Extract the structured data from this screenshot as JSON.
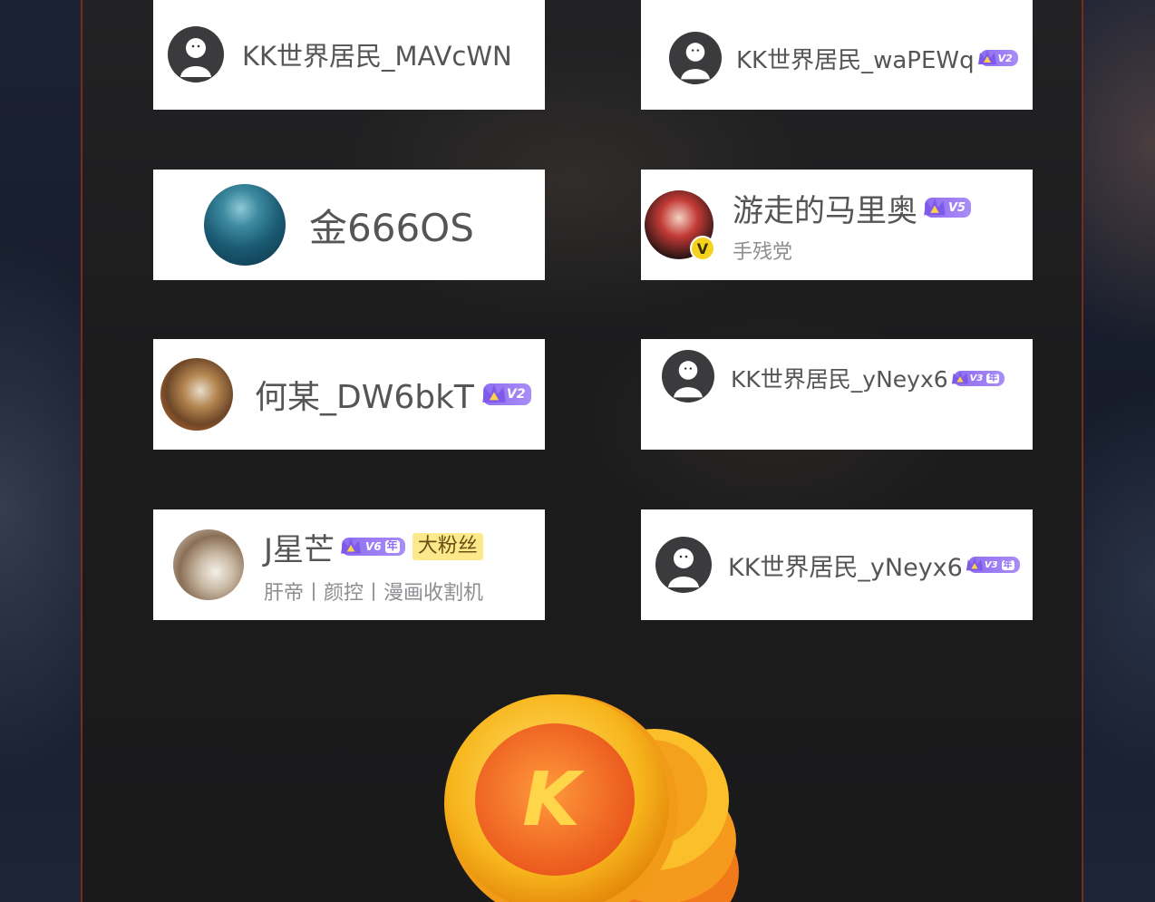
{
  "users": [
    {
      "name": "KK世界居民_MAVcWN",
      "vip": "",
      "avatar": "default-avatar-icon"
    },
    {
      "name": "KK世界居民_waPEWq",
      "vip": "V2",
      "vip_year": "",
      "avatar": "default-avatar-icon"
    },
    {
      "name": "金666OS",
      "vip": "",
      "avatar": "moon-avatar"
    },
    {
      "name": "游走的马里奥",
      "vip": "V5",
      "vip_year": "",
      "subtitle": "手残党",
      "verified_label": "V",
      "avatar": "anime-avatar"
    },
    {
      "name": "何某_DW6bkT",
      "vip": "V2",
      "vip_year": "",
      "avatar": "cartoon-avatar"
    },
    {
      "name": "KK世界居民_yNeyx6",
      "vip": "V3",
      "vip_year": "年",
      "avatar": "default-avatar-icon"
    },
    {
      "name": "J星芒",
      "vip": "V6",
      "vip_year": "年",
      "fan_badge": "大粉丝",
      "subtitle": "肝帝丨颜控丨漫画收割机",
      "avatar": "sparkle-avatar"
    },
    {
      "name": "KK世界居民_yNeyx6",
      "vip": "V3",
      "vip_year": "年",
      "avatar": "default-avatar-icon"
    }
  ],
  "coin_logo_letter": "K",
  "colors": {
    "vip_purple": "#8f6df0",
    "fan_badge_yellow": "#fbe98b",
    "verified_yellow": "#f5d21e",
    "panel_border": "#7a2a20",
    "coin_gold": "#f7b51c"
  }
}
